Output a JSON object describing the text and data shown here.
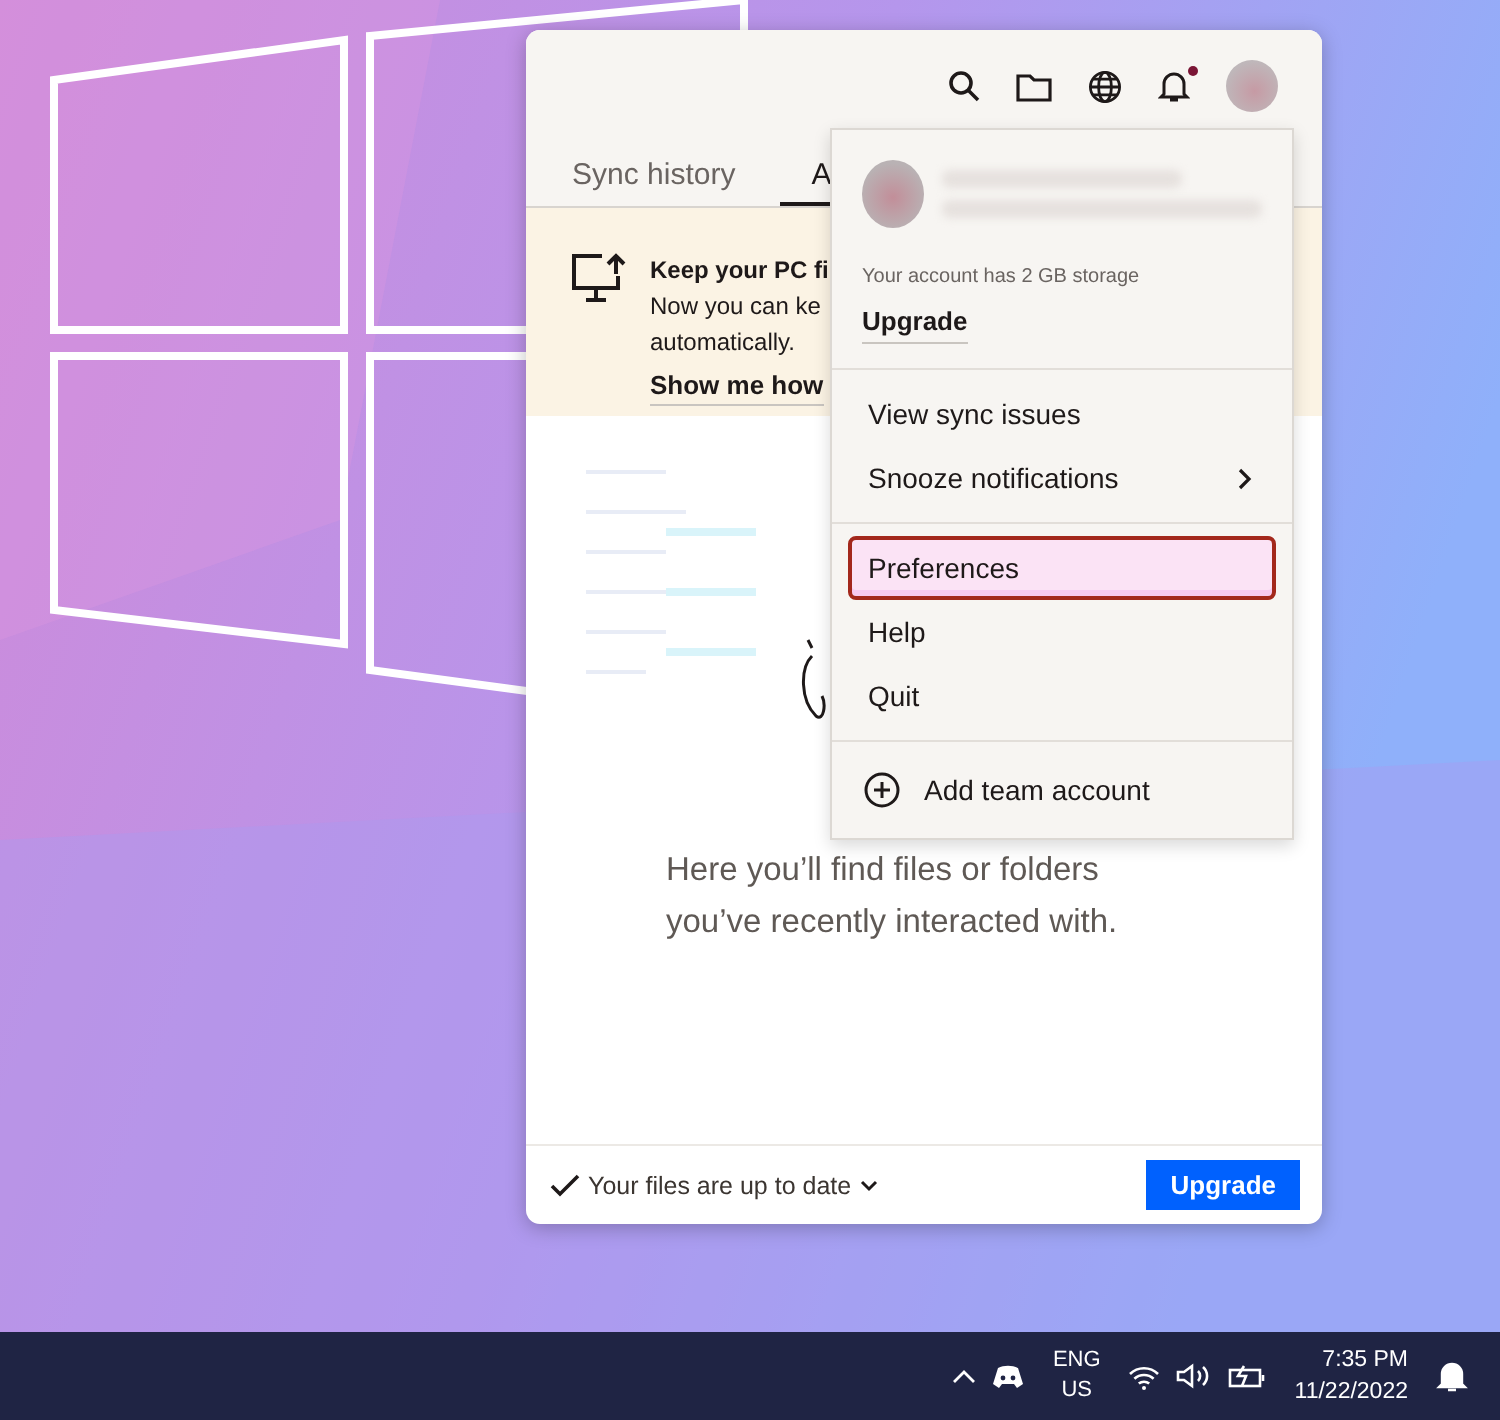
{
  "toolbar": {
    "notifications_unread": true
  },
  "tabs": [
    {
      "label": "Sync history",
      "selected": false
    },
    {
      "label": "A",
      "selected": true
    }
  ],
  "banner": {
    "title": "Keep your PC fi",
    "lines": [
      "Now you can ke",
      "automatically."
    ],
    "link": "Show me how"
  },
  "empty_state": {
    "message": "Here you’ll find files or folders you’ve recently interacted with."
  },
  "footer": {
    "status": "Your files are up to date",
    "button": "Upgrade"
  },
  "account_menu": {
    "storage": "Your account has 2 GB storage",
    "upgrade": "Upgrade",
    "groups": [
      [
        {
          "label": "View sync issues",
          "submenu": false,
          "selected": false
        },
        {
          "label": "Snooze notifications",
          "submenu": true,
          "selected": false
        }
      ],
      [
        {
          "label": "Preferences",
          "submenu": false,
          "selected": true
        },
        {
          "label": "Help",
          "submenu": false,
          "selected": false
        },
        {
          "label": "Quit",
          "submenu": false,
          "selected": false
        }
      ]
    ],
    "add_account": "Add team account"
  },
  "taskbar": {
    "language": "ENG",
    "region": "US",
    "time": "7:35 PM",
    "date": "11/22/2022"
  }
}
